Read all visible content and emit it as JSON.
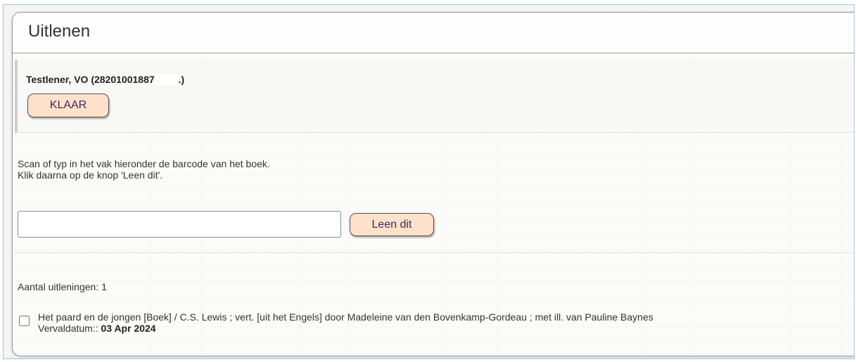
{
  "panel": {
    "title": "Uitlenen"
  },
  "borrower": {
    "name_prefix": "Testlener, VO (28201001887",
    "name_suffix": ".)",
    "done_button": "KLAAR"
  },
  "scan": {
    "instruction_line1": "Scan of typ in het vak hieronder de barcode van het boek.",
    "instruction_line2": "Klik daarna op de knop 'Leen dit'.",
    "barcode_value": "",
    "lend_button": "Leen dit"
  },
  "loans": {
    "count_label": "Aantal uitleningen: 1",
    "items": [
      {
        "title": "Het paard en de jongen [Boek] / C.S. Lewis ; vert. [uit het Engels] door Madeleine van den Bovenkamp-Gordeau ; met ill. van Pauline Baynes",
        "due_label": "Vervaldatum:: ",
        "due_date": "03 Apr 2024",
        "checked": false
      }
    ]
  },
  "colors": {
    "button_bg": "#fde1c8",
    "button_text": "#3a2a6a",
    "frame_border": "#a9c4e0"
  }
}
